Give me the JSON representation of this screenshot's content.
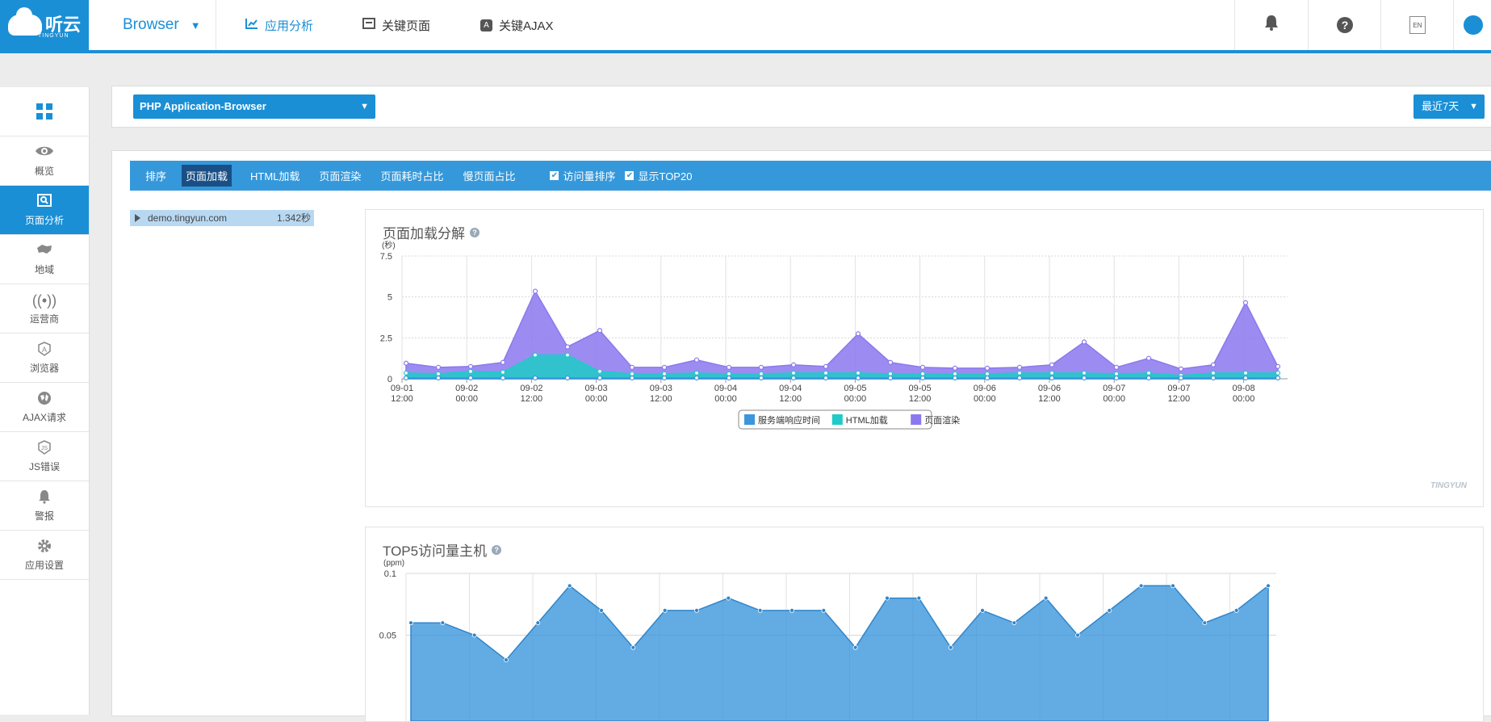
{
  "header": {
    "logo_text": "听云",
    "logo_sub": "TINGYUN",
    "app_name": "Browser",
    "nav": [
      {
        "label": "应用分析",
        "icon": "line-chart-icon"
      },
      {
        "label": "关键页面",
        "icon": "page-icon"
      },
      {
        "label": "关键AJAX",
        "icon": "ajax-icon"
      }
    ],
    "help_glyph": "?",
    "lang_badge": "EN"
  },
  "sidebar": {
    "items": [
      {
        "label": "概览",
        "icon": "eye-icon"
      },
      {
        "label": "页面分析",
        "icon": "page-analysis-icon",
        "active": true
      },
      {
        "label": "地域",
        "icon": "map-icon"
      },
      {
        "label": "运营商",
        "icon": "signal-icon"
      },
      {
        "label": "浏览器",
        "icon": "browser-icon"
      },
      {
        "label": "AJAX请求",
        "icon": "globe-icon"
      },
      {
        "label": "JS错误",
        "icon": "js-icon"
      },
      {
        "label": "警报",
        "icon": "bell-icon"
      },
      {
        "label": "应用设置",
        "icon": "gear-icon"
      }
    ]
  },
  "selector": {
    "app": "PHP Application-Browser",
    "time_range": "最近7天"
  },
  "tabs": [
    "排序",
    "页面加载",
    "HTML加载",
    "页面渲染",
    "页面耗时占比",
    "慢页面占比"
  ],
  "active_tab": 1,
  "checks": [
    "访问量排序",
    "显示TOP20"
  ],
  "hosts": [
    {
      "name": "demo.tingyun.com",
      "value": "1.342秒"
    }
  ],
  "watermark": "TINGYUN",
  "chart_data": [
    {
      "type": "area",
      "title": "页面加载分解",
      "ylabel": "(秒)",
      "ylim": [
        0,
        7.5
      ],
      "yticks": [
        "0",
        "2.5",
        "5",
        "7.5"
      ],
      "xticks": [
        [
          "09-01",
          "12:00"
        ],
        [
          "09-02",
          "00:00"
        ],
        [
          "09-02",
          "12:00"
        ],
        [
          "09-03",
          "00:00"
        ],
        [
          "09-03",
          "12:00"
        ],
        [
          "09-04",
          "00:00"
        ],
        [
          "09-04",
          "12:00"
        ],
        [
          "09-05",
          "00:00"
        ],
        [
          "09-05",
          "12:00"
        ],
        [
          "09-06",
          "00:00"
        ],
        [
          "09-06",
          "12:00"
        ],
        [
          "09-07",
          "00:00"
        ],
        [
          "09-07",
          "12:00"
        ],
        [
          "09-08",
          "00:00"
        ]
      ],
      "grid": true,
      "legend": "bottom-center",
      "stacked": true,
      "series": [
        {
          "name": "服务端响应时间",
          "color": "#3c96dc",
          "values": [
            0.05,
            0.05,
            0.05,
            0.05,
            0.05,
            0.05,
            0.05,
            0.05,
            0.05,
            0.05,
            0.05,
            0.05,
            0.05,
            0.05,
            0.05,
            0.05,
            0.05,
            0.05,
            0.05,
            0.05,
            0.05,
            0.05,
            0.05,
            0.05,
            0.05,
            0.05,
            0.05,
            0.05
          ]
        },
        {
          "name": "HTML加载",
          "color": "#1ecbc8",
          "values": [
            0.3,
            0.25,
            0.4,
            0.35,
            1.4,
            1.4,
            0.4,
            0.25,
            0.25,
            0.3,
            0.25,
            0.25,
            0.3,
            0.3,
            0.3,
            0.25,
            0.25,
            0.25,
            0.25,
            0.3,
            0.3,
            0.3,
            0.25,
            0.3,
            0.15,
            0.3,
            0.3,
            0.3
          ]
        },
        {
          "name": "页面渲染",
          "color": "#8b78ee",
          "values": [
            0.6,
            0.4,
            0.3,
            0.6,
            3.9,
            0.5,
            2.5,
            0.4,
            0.4,
            0.8,
            0.4,
            0.4,
            0.5,
            0.4,
            2.4,
            0.7,
            0.4,
            0.35,
            0.35,
            0.35,
            0.5,
            1.9,
            0.4,
            0.9,
            0.4,
            0.5,
            4.3,
            0.4
          ]
        }
      ]
    },
    {
      "type": "area",
      "title": "TOP5访问量主机",
      "ylabel": "(ppm)",
      "ylim": [
        0,
        0.1
      ],
      "yticks": [
        "0.05",
        "0.1"
      ],
      "grid": true,
      "series": [
        {
          "color": "#3c96dc",
          "values": [
            0.06,
            0.06,
            0.05,
            0.03,
            0.06,
            0.09,
            0.07,
            0.04,
            0.07,
            0.07,
            0.08,
            0.07,
            0.07,
            0.07,
            0.04,
            0.08,
            0.08,
            0.04,
            0.07,
            0.06,
            0.08,
            0.05,
            0.07,
            0.09,
            0.09,
            0.06,
            0.07,
            0.09
          ]
        }
      ]
    }
  ]
}
